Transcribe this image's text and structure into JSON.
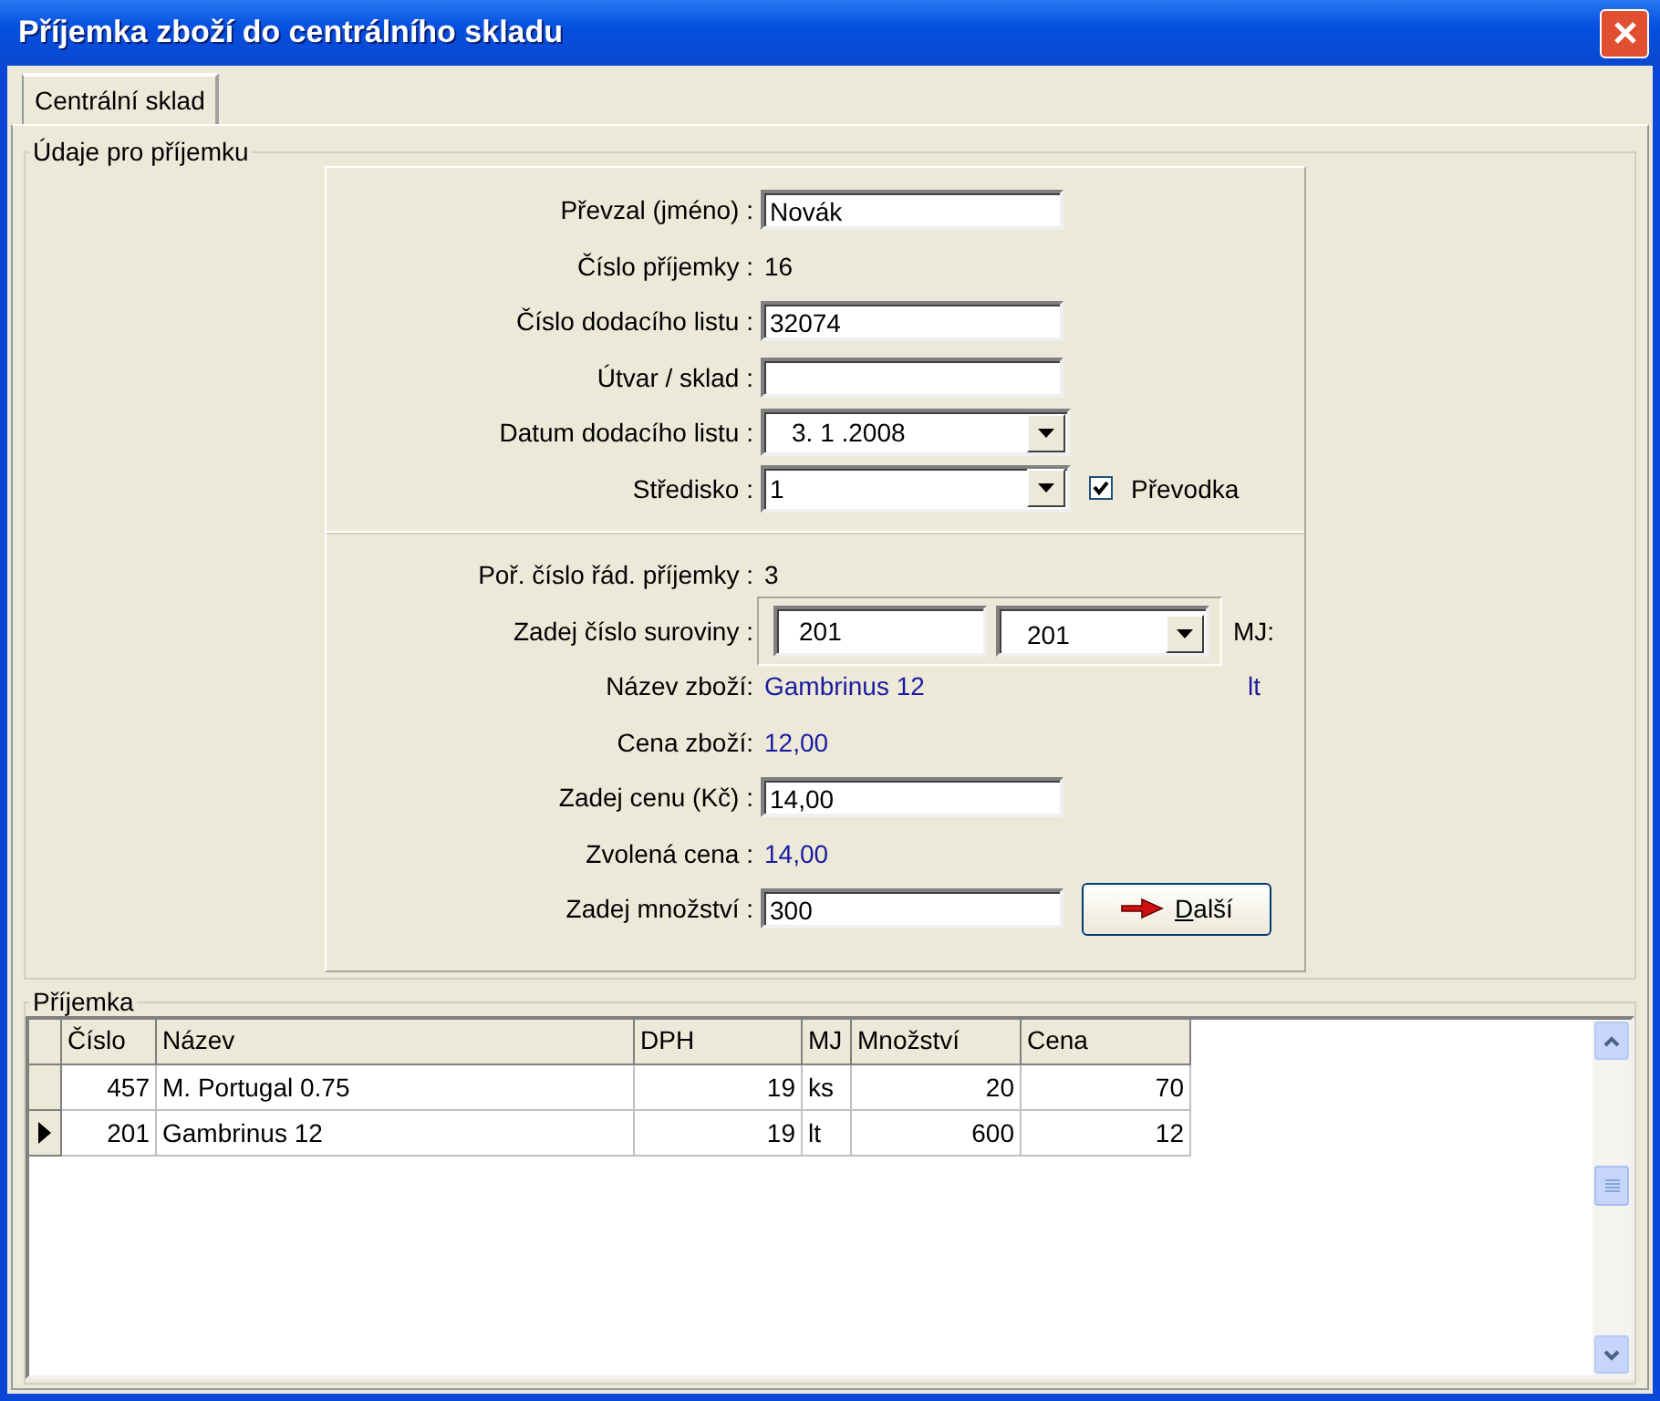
{
  "window": {
    "title": "Příjemka zboží do centrálního skladu"
  },
  "tabs": [
    {
      "label": "Centrální sklad",
      "selected": true
    }
  ],
  "details": {
    "title": "Údaje pro příjemku",
    "upper": [
      {
        "kind": "input",
        "label": "Převzal (jméno) :",
        "value": "Novák"
      },
      {
        "kind": "readout",
        "label": "Číslo příjemky :",
        "value": "16",
        "emphasis": false
      },
      {
        "kind": "input",
        "label": "Číslo dodacího listu :",
        "value": "32074"
      },
      {
        "kind": "input",
        "label": "Útvar / sklad :"
      },
      {
        "kind": "select",
        "label": "Datum dodacího listu :",
        "value": "3. 1 .2008"
      },
      {
        "kind": "select",
        "label": "Středisko :",
        "value": "1",
        "checkbox": {
          "label": "Převodka",
          "checked": true
        }
      }
    ],
    "lower": [
      {
        "kind": "readout",
        "label": "Poř. číslo řád. příjemky :",
        "value": "3",
        "emphasis": false
      },
      {
        "kind": "code",
        "label": "Zadej číslo suroviny :",
        "value": "201",
        "select_value": "201",
        "unit_label": "MJ:"
      },
      {
        "kind": "readout",
        "label": "Název zboží:",
        "value": "Gambrinus 12",
        "emphasis": true,
        "unit": "lt"
      },
      {
        "kind": "readout",
        "label": "Cena zboží:",
        "value": "12,00",
        "emphasis": true
      },
      {
        "kind": "input",
        "label": "Zadej cenu (Kč) :",
        "value": "14,00"
      },
      {
        "kind": "readout",
        "label": "Zvolená cena :",
        "value": "14,00",
        "emphasis": true
      },
      {
        "kind": "input",
        "label": "Zadej množství :",
        "value": "300",
        "button": {
          "label": "Další"
        }
      }
    ]
  },
  "receipt": {
    "title": "Příjemka",
    "columns": [
      {
        "label": "Číslo",
        "numeric": true
      },
      {
        "label": "Název",
        "numeric": false
      },
      {
        "label": "DPH",
        "numeric": true
      },
      {
        "label": "MJ",
        "numeric": false
      },
      {
        "label": "Množství",
        "numeric": true
      },
      {
        "label": "Cena",
        "numeric": true
      }
    ],
    "rows": [
      {
        "selected": false,
        "cells": [
          "457",
          "M. Portugal 0.75",
          "19",
          "ks",
          "20",
          "70"
        ]
      },
      {
        "selected": true,
        "cells": [
          "201",
          "Gambrinus 12",
          "19",
          "lt",
          "600",
          "12"
        ]
      }
    ]
  }
}
